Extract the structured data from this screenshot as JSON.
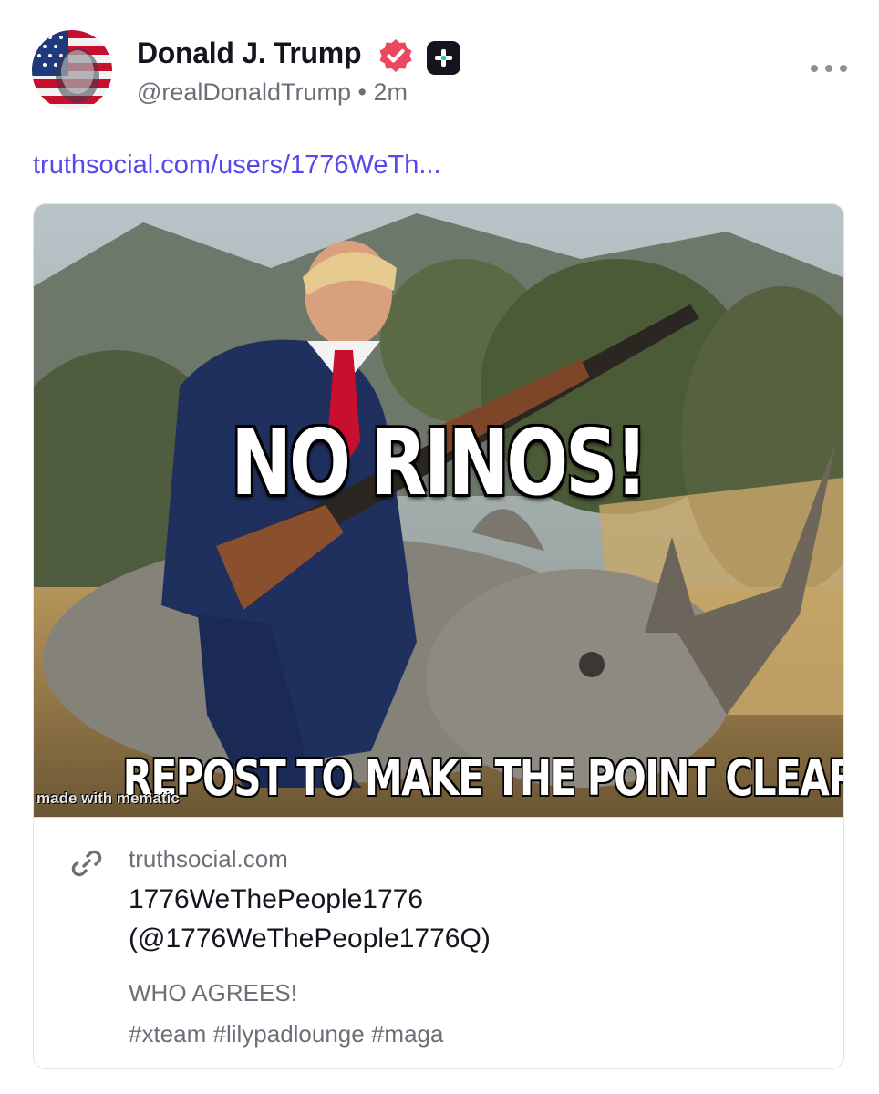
{
  "post": {
    "author": {
      "name": "Donald J. Trump",
      "handle": "@realDonaldTrump",
      "separator": "•",
      "time": "2m",
      "avatar_icon": "flag-portrait-avatar",
      "verified_icon": "verified-badge-icon",
      "plus_icon": "truth-plus-icon"
    },
    "more_icon": "more-options-icon",
    "link_text": "truthsocial.com/users/1776WeTh...",
    "image_text": {
      "top": "NO RINOS!",
      "bottom": "REPOST TO MAKE THE POINT CLEAR",
      "watermark": "made with mematic"
    },
    "link_card": {
      "icon": "link-icon",
      "domain": "truthsocial.com",
      "title_line1": "1776WeThePeople1776",
      "title_line2": "(@1776WeThePeople1776Q)",
      "description": "WHO AGREES!",
      "tags": "#xteam #lilypadlounge #maga"
    }
  },
  "colors": {
    "link": "#5448ee",
    "text": "#14141e",
    "muted": "#6e6e78",
    "verified": "#ec4760",
    "plus_badge": "#14141e",
    "plus_accent": "#19d79b"
  }
}
